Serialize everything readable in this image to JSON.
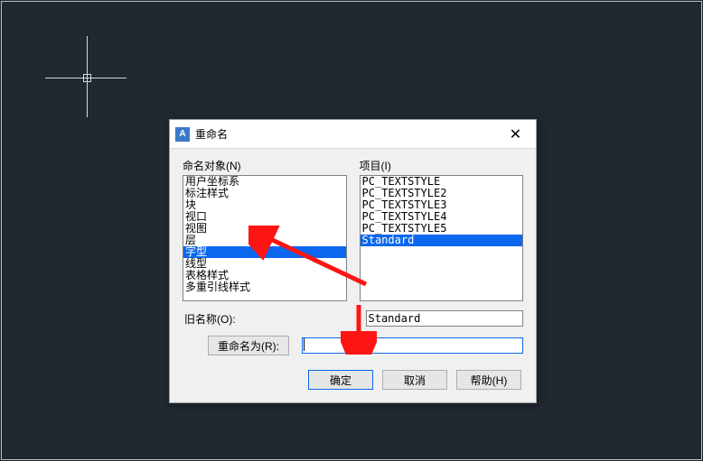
{
  "dialog": {
    "title": "重命名",
    "icon_text": "A",
    "close_glyph": "✕",
    "named_objects_label": "命名对象(N)",
    "items_label": "项目(I)",
    "old_name_label": "旧名称(O):",
    "rename_to_label": "重命名为(R):",
    "ok_label": "确定",
    "cancel_label": "取消",
    "help_label": "帮助(H)",
    "named_objects": [
      "用户坐标系",
      "标注样式",
      "块",
      "视口",
      "视图",
      "层",
      "字型",
      "线型",
      "表格样式",
      "多重引线样式"
    ],
    "selected_named_object_index": 6,
    "items": [
      "PC_TEXTSTYLE",
      "PC_TEXTSTYLE2",
      "PC_TEXTSTYLE3",
      "PC_TEXTSTYLE4",
      "PC_TEXTSTYLE5",
      "Standard"
    ],
    "selected_item_index": 5,
    "old_name_value": "Standard",
    "rename_to_value": ""
  },
  "colors": {
    "accent": "#0a67ee",
    "arrow": "#ff1414"
  }
}
